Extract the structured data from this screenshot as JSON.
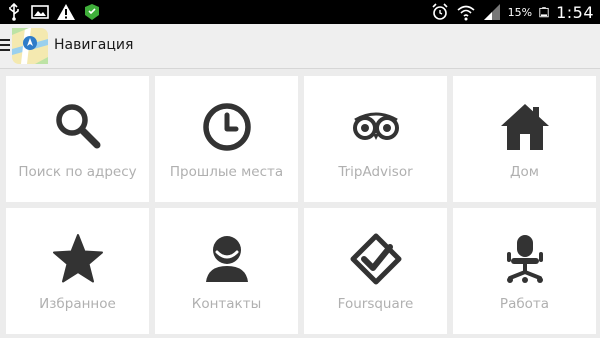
{
  "status_bar": {
    "icons_left": [
      "usb-icon",
      "image-icon",
      "warning-icon",
      "android-icon"
    ],
    "battery_percent": "15%",
    "time": "1:54",
    "icons_right": [
      "alarm-icon",
      "wifi-icon",
      "signal-icon",
      "battery-icon"
    ]
  },
  "action_bar": {
    "title": "Навигация"
  },
  "tiles": [
    {
      "label": "Поиск по адресу",
      "icon": "search-icon"
    },
    {
      "label": "Прошлые места",
      "icon": "clock-icon"
    },
    {
      "label": "TripAdvisor",
      "icon": "owl-eyes-icon"
    },
    {
      "label": "Дом",
      "icon": "home-icon"
    },
    {
      "label": "Избранное",
      "icon": "star-icon"
    },
    {
      "label": "Контакты",
      "icon": "person-icon"
    },
    {
      "label": "Foursquare",
      "icon": "foursquare-check-icon"
    },
    {
      "label": "Работа",
      "icon": "office-chair-icon"
    }
  ],
  "colors": {
    "icon": "#333333",
    "label": "#b0b0b0",
    "tile_bg": "#ffffff",
    "page_bg": "#ececec"
  }
}
